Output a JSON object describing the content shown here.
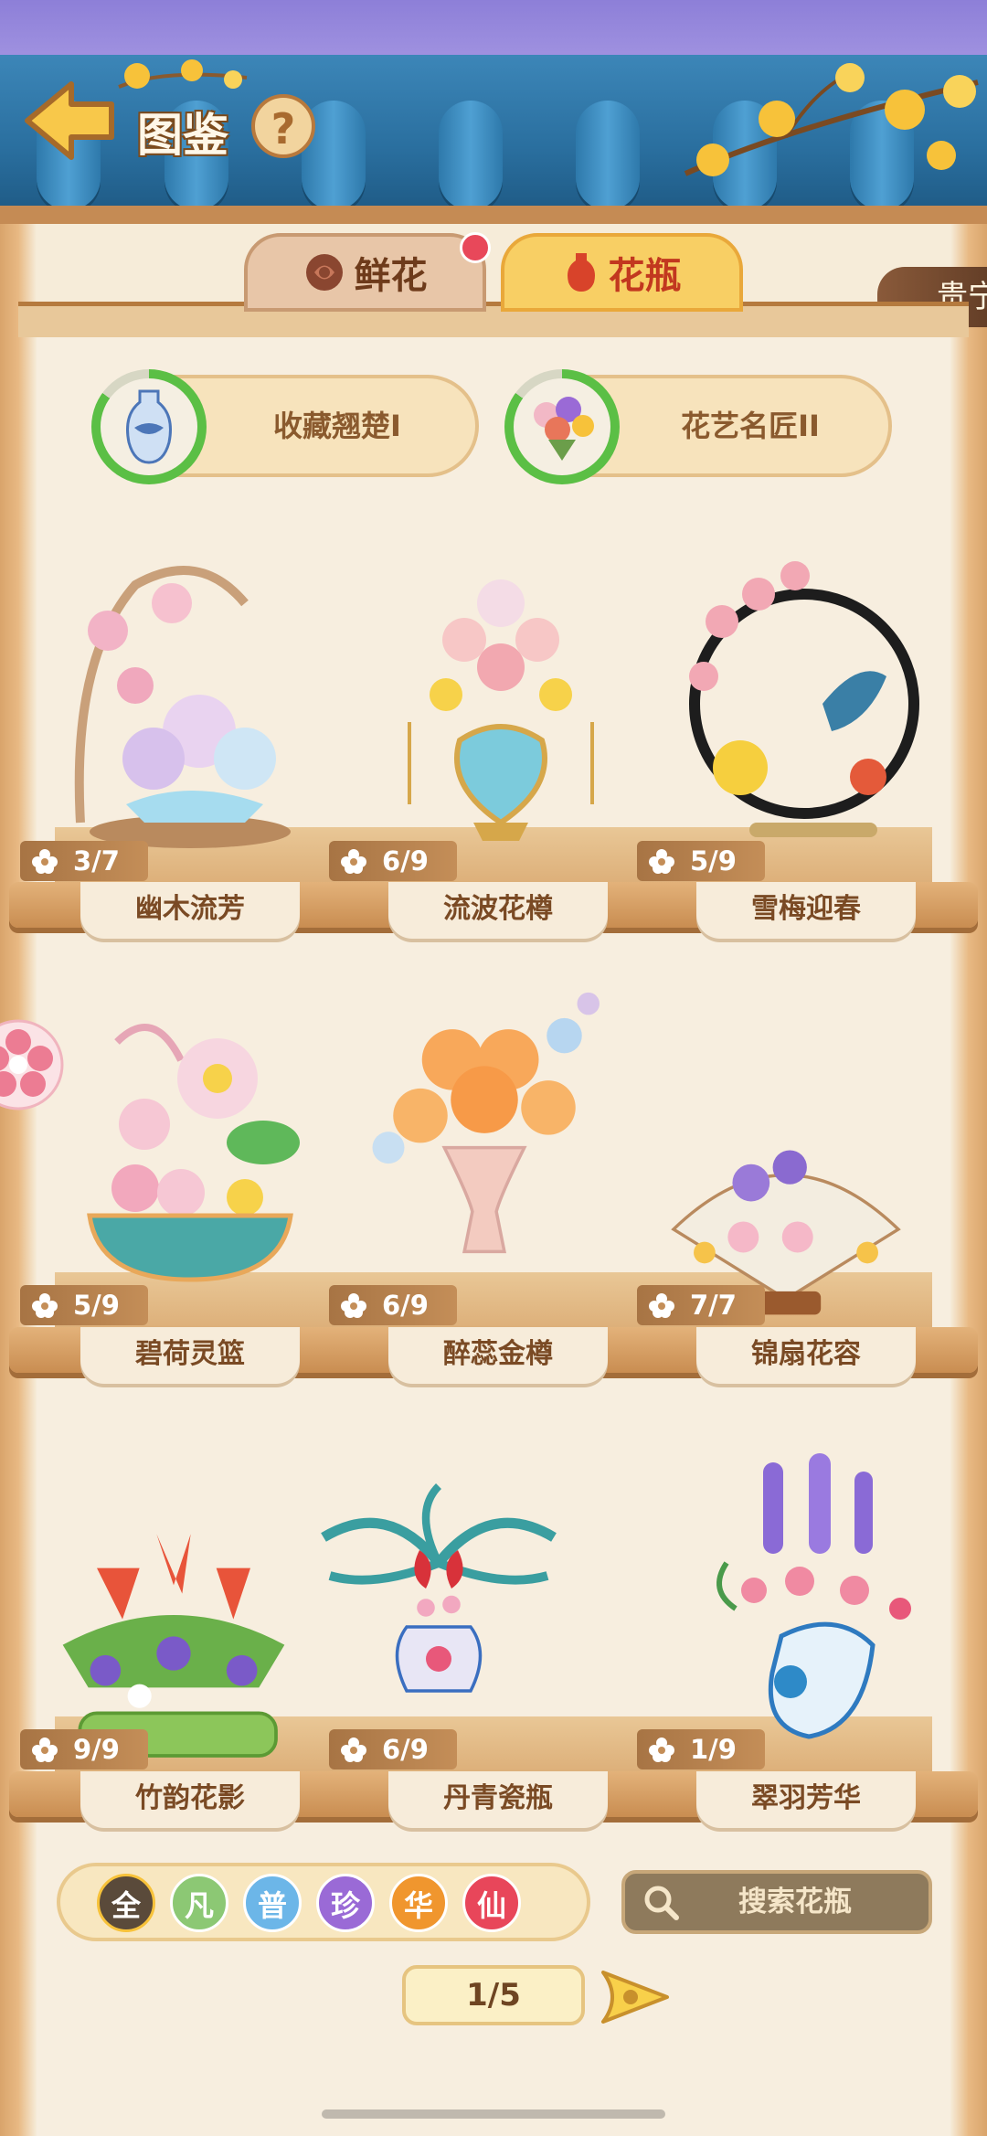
{
  "header": {
    "title": "图鉴",
    "help": "?"
  },
  "side_label": "贵宁",
  "tabs": [
    {
      "label": "鲜花",
      "active": false,
      "badge": true
    },
    {
      "label": "花瓶",
      "active": true,
      "badge": false
    }
  ],
  "achievements": [
    {
      "label": "收藏翘楚I",
      "icon": "vase-icon",
      "progress": 0.85
    },
    {
      "label": "花艺名匠II",
      "icon": "bouquet-icon",
      "progress": 0.85
    }
  ],
  "items": [
    {
      "name": "幽木流芳",
      "count": "3/7"
    },
    {
      "name": "流波花樽",
      "count": "6/9"
    },
    {
      "name": "雪梅迎春",
      "count": "5/9"
    },
    {
      "name": "碧荷灵篮",
      "count": "5/9"
    },
    {
      "name": "醉蕊金樽",
      "count": "6/9"
    },
    {
      "name": "锦扇花容",
      "count": "7/7"
    },
    {
      "name": "竹韵花影",
      "count": "9/9"
    },
    {
      "name": "丹青瓷瓶",
      "count": "6/9"
    },
    {
      "name": "翠羽芳华",
      "count": "1/9"
    }
  ],
  "filters": [
    {
      "label": "全",
      "color": "#5a4a3a",
      "selected": true
    },
    {
      "label": "凡",
      "color": "#8cc874",
      "selected": false
    },
    {
      "label": "普",
      "color": "#6cb6e8",
      "selected": false
    },
    {
      "label": "珍",
      "color": "#9a6ad6",
      "selected": false
    },
    {
      "label": "华",
      "color": "#f0962e",
      "selected": false
    },
    {
      "label": "仙",
      "color": "#e8465a",
      "selected": false
    }
  ],
  "search": {
    "label": "搜索花瓶"
  },
  "pager": {
    "label": "1/5"
  }
}
